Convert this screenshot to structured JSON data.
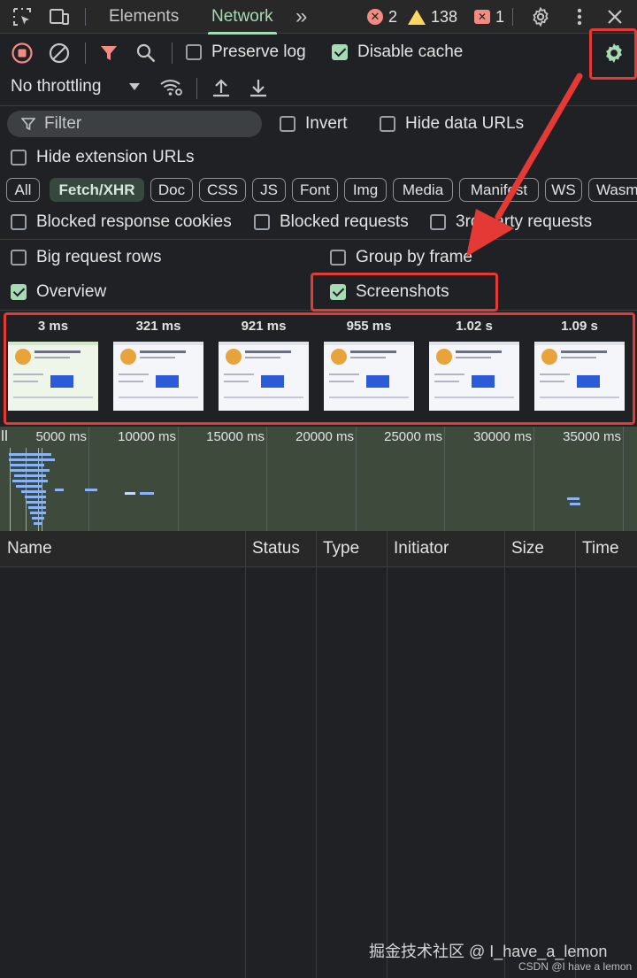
{
  "tabbar": {
    "tabs": [
      {
        "label": "Elements",
        "active": false
      },
      {
        "label": "Network",
        "active": true
      }
    ],
    "more": "»",
    "errors": "2",
    "warnings": "138",
    "issues": "1"
  },
  "toolbar": {
    "preserve_log": {
      "label": "Preserve log",
      "checked": false
    },
    "disable_cache": {
      "label": "Disable cache",
      "checked": true
    },
    "throttling": "No throttling"
  },
  "filter": {
    "placeholder": "Filter",
    "invert": {
      "label": "Invert",
      "checked": false
    },
    "hide_data_urls": {
      "label": "Hide data URLs",
      "checked": false
    },
    "hide_extension_urls": {
      "label": "Hide extension URLs",
      "checked": false
    }
  },
  "chips": [
    "All",
    "Fetch/XHR",
    "Doc",
    "CSS",
    "JS",
    "Font",
    "Img",
    "Media",
    "Manifest",
    "WS",
    "Wasm"
  ],
  "chip_selected": "Fetch/XHR",
  "blocked": {
    "cookies": {
      "label": "Blocked response cookies",
      "checked": false
    },
    "requests": {
      "label": "Blocked requests",
      "checked": false
    },
    "third_party": {
      "label": "3rd-party requests",
      "checked": false
    }
  },
  "settings": {
    "big_rows": {
      "label": "Big request rows",
      "checked": false
    },
    "group_by_frame": {
      "label": "Group by frame",
      "checked": false
    },
    "overview": {
      "label": "Overview",
      "checked": true
    },
    "screenshots": {
      "label": "Screenshots",
      "checked": true
    }
  },
  "screenshots": [
    "3 ms",
    "321 ms",
    "921 ms",
    "955 ms",
    "1.02 s",
    "1.09 s"
  ],
  "overview_ticks": [
    "5000 ms",
    "10000 ms",
    "15000 ms",
    "20000 ms",
    "25000 ms",
    "30000 ms",
    "35000 ms"
  ],
  "table_columns": [
    "Name",
    "Status",
    "Type",
    "Initiator",
    "Size",
    "Time"
  ],
  "watermark": {
    "line1": "掘金技术社区 @ I_have_a_lemon",
    "line2": "CSDN @I have a lemon"
  },
  "colors": {
    "accent": "#a8dab5",
    "annotation": "#e53935",
    "error": "#f28b82",
    "warning": "#fdd663"
  }
}
